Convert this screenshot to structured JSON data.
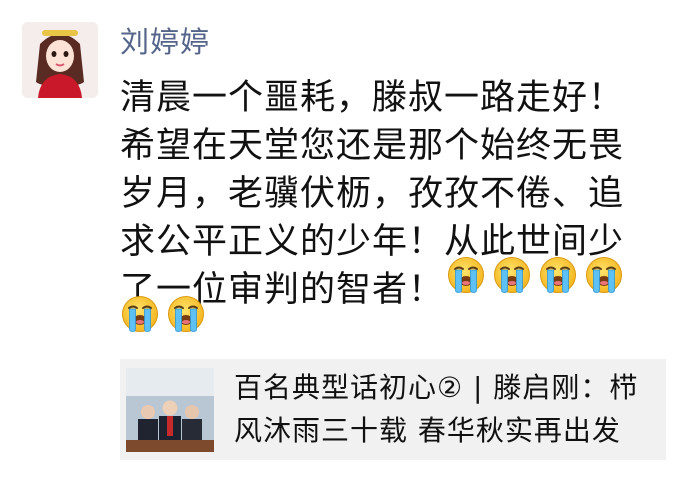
{
  "post": {
    "author": "刘婷婷",
    "text_lines": [
      "清晨一个噩耗，滕叔一路走好！",
      "希望在天堂您还是那个始终无畏",
      "岁月，老骥伏枥，孜孜不倦、追",
      "求公平正义的少年！从此世间少",
      "了一位审判的智者！"
    ],
    "emoji_name": "crying-face"
  },
  "link_card": {
    "title_lines": [
      "百名典型话初心② | 滕启刚：栉",
      "风沐雨三十载 春华秋实再出发"
    ]
  }
}
